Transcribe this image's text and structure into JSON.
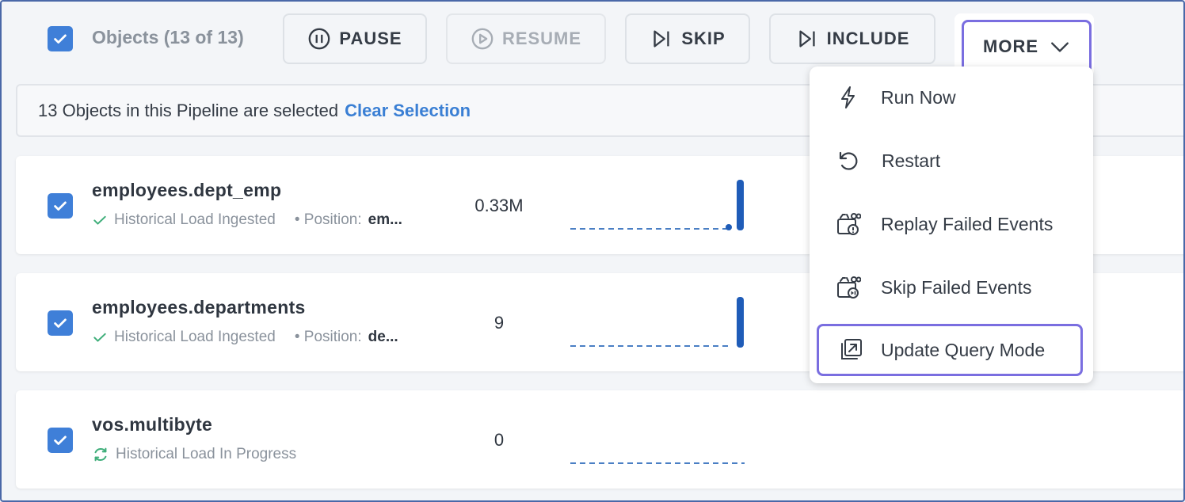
{
  "toolbar": {
    "objects_label": "Objects (13 of 13)",
    "pause_label": "PAUSE",
    "resume_label": "RESUME",
    "skip_label": "SKIP",
    "include_label": "INCLUDE",
    "more_label": "MORE"
  },
  "selection": {
    "text": "13 Objects in this Pipeline are selected",
    "clear_label": "Clear Selection"
  },
  "rows": [
    {
      "title": "employees.dept_emp",
      "status": "Historical Load Ingested",
      "position_label": "• Position:",
      "position_value": "em...",
      "count": "0.33M"
    },
    {
      "title": "employees.departments",
      "status": "Historical Load Ingested",
      "position_label": "• Position:",
      "position_value": "de...",
      "count": "9"
    },
    {
      "title": "vos.multibyte",
      "status": "Historical Load In Progress",
      "position_label": "",
      "position_value": "",
      "count": "0"
    }
  ],
  "menu": {
    "items": [
      {
        "label": "Run Now",
        "icon": "lightning-icon"
      },
      {
        "label": "Restart",
        "icon": "restart-icon"
      },
      {
        "label": "Replay Failed Events",
        "icon": "replay-failed-icon"
      },
      {
        "label": "Skip Failed Events",
        "icon": "skip-failed-icon"
      },
      {
        "label": "Update Query Mode",
        "icon": "update-query-icon"
      }
    ]
  },
  "colors": {
    "accent": "#3f7fd8",
    "highlight_border": "#7a6ee0",
    "link": "#3a7fd4",
    "success": "#3fae7a"
  }
}
